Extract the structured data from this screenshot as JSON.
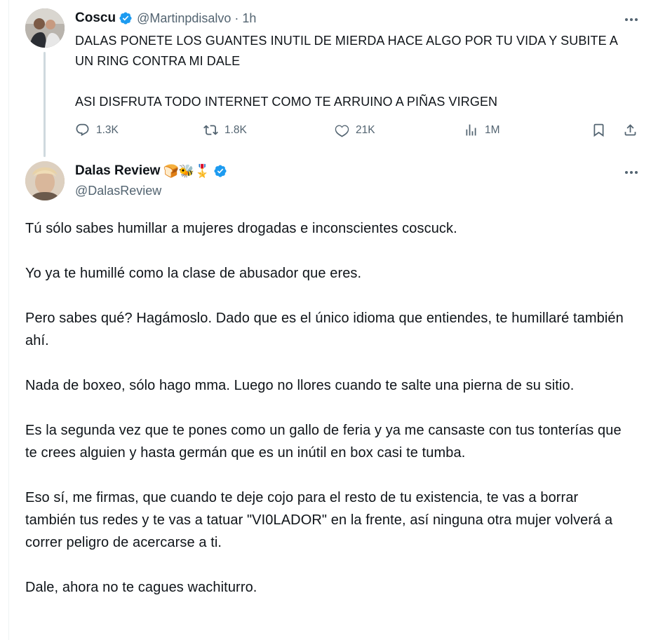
{
  "tweet1": {
    "author_name": "Coscu",
    "handle": "@Martinpdisalvo",
    "separator": "·",
    "time": "1h",
    "text_lines": [
      "DALAS PONETE LOS GUANTES INUTIL DE MIERDA HACE ALGO POR TU VIDA Y SUBITE A UN RING CONTRA MI DALE",
      "ASI DISFRUTA TODO INTERNET COMO TE ARRUINO A PIÑAS VIRGEN"
    ],
    "replies": "1.3K",
    "retweets": "1.8K",
    "likes": "21K",
    "views": "1M"
  },
  "tweet2": {
    "author_name": "Dalas Review",
    "emojis": "🍞🐝🎖️",
    "handle": "@DalasReview",
    "paragraphs": [
      "Tú sólo sabes humillar a mujeres drogadas e inconscientes coscuck.",
      "Yo ya te humillé como la clase de abusador que eres.",
      "Pero sabes qué? Hagámoslo. Dado que es el único idioma que entiendes, te humillaré también ahí.",
      "Nada de boxeo, sólo hago mma. Luego no llores cuando te salte una pierna de su sitio.",
      "Es la segunda vez que te pones como un gallo de feria y ya me cansaste con tus tonterías que te crees alguien y hasta germán que es un inútil en box casi te tumba.",
      "Eso sí, me firmas, que cuando te deje cojo para el resto de tu existencia, te vas a borrar también tus redes y te vas a tatuar \"VI0LADOR\" en la frente, así ninguna otra mujer volverá a correr peligro de acercarse a ti.",
      "Dale, ahora no te cagues wachiturro."
    ]
  },
  "icons": {
    "verified": "verified-badge-icon",
    "reply": "reply-icon",
    "retweet": "retweet-icon",
    "like": "heart-icon",
    "views": "views-icon",
    "bookmark": "bookmark-icon",
    "share": "share-icon",
    "more": "more-icon"
  },
  "colors": {
    "text": "#0f1419",
    "secondary": "#536471",
    "verified": "#1d9bf0",
    "thread_line": "#cfd9de"
  }
}
